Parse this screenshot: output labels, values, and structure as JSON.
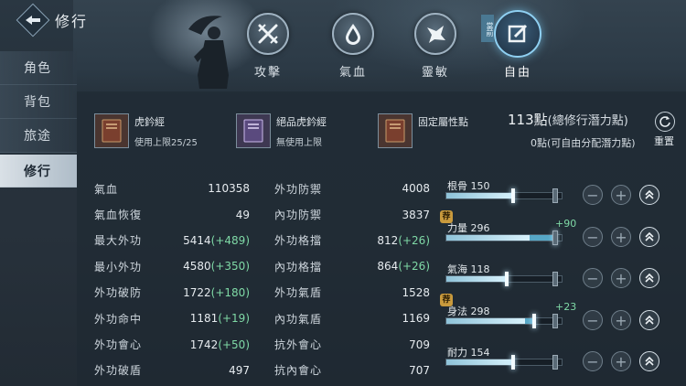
{
  "header": {
    "title": "修行"
  },
  "sidebar": {
    "items": [
      {
        "label": "角色",
        "active": false
      },
      {
        "label": "背包",
        "active": false
      },
      {
        "label": "旅途",
        "active": false
      },
      {
        "label": "修行",
        "active": true
      }
    ]
  },
  "tabs": [
    {
      "label": "攻擊",
      "icon": "crossed-swords-icon"
    },
    {
      "label": "氣血",
      "icon": "drop-icon"
    },
    {
      "label": "靈敏",
      "icon": "wing-icon"
    },
    {
      "label": "自由",
      "icon": "edit-icon",
      "active": true,
      "tag": "當前"
    }
  ],
  "books": [
    {
      "name": "虎鈐經",
      "sub": "使用上限25/25",
      "color": "#7a3f2e"
    },
    {
      "name": "絕品虎鈐經",
      "sub": "無使用上限",
      "color": "#5a4a7e"
    },
    {
      "name": "固定屬性點",
      "sub": "",
      "color": "#7a3f2e"
    }
  ],
  "points": {
    "total_value": "113點",
    "total_label": "(總修行潛力點)",
    "free_value": "0點",
    "free_label": "(可自由分配潛力點)",
    "reset_label": "重置"
  },
  "stats_left": [
    {
      "name": "氣血",
      "value": "110358",
      "bonus": ""
    },
    {
      "name": "氣血恢復",
      "value": "49",
      "bonus": ""
    },
    {
      "name": "最大外功",
      "value": "5414",
      "bonus": "(+489)"
    },
    {
      "name": "最小外功",
      "value": "4580",
      "bonus": "(+350)"
    },
    {
      "name": "外功破防",
      "value": "1722",
      "bonus": "(+180)"
    },
    {
      "name": "外功命中",
      "value": "1181",
      "bonus": "(+19)"
    },
    {
      "name": "外功會心",
      "value": "1742",
      "bonus": "(+50)"
    },
    {
      "name": "外功破盾",
      "value": "497",
      "bonus": ""
    }
  ],
  "stats_right": [
    {
      "name": "外功防禦",
      "value": "4008",
      "bonus": ""
    },
    {
      "name": "內功防禦",
      "value": "3837",
      "bonus": ""
    },
    {
      "name": "外功格擋",
      "value": "812",
      "bonus": "(+26)"
    },
    {
      "name": "內功格擋",
      "value": "864",
      "bonus": "(+26)"
    },
    {
      "name": "外功氣盾",
      "value": "1528",
      "bonus": ""
    },
    {
      "name": "內功氣盾",
      "value": "1169",
      "bonus": ""
    },
    {
      "name": "抗外會心",
      "value": "709",
      "bonus": ""
    },
    {
      "name": "抗內會心",
      "value": "707",
      "bonus": ""
    }
  ],
  "attributes": [
    {
      "label": "根骨 150",
      "plus": "",
      "fill": 0.58,
      "extra": 0,
      "seal": ""
    },
    {
      "label": "力量 296",
      "plus": "+90",
      "fill": 0.72,
      "extra": 0.22,
      "seal": "荐"
    },
    {
      "label": "氣海 118",
      "plus": "",
      "fill": 0.52,
      "extra": 0,
      "seal": ""
    },
    {
      "label": "身法 298",
      "plus": "+23",
      "fill": 0.68,
      "extra": 0.08,
      "seal": "荐"
    },
    {
      "label": "耐力 154",
      "plus": "",
      "fill": 0.58,
      "extra": 0,
      "seal": ""
    }
  ],
  "colors": {
    "accent": "#8fd0f2",
    "bonus": "#7fd9a6",
    "seal": "#c99a3d"
  }
}
